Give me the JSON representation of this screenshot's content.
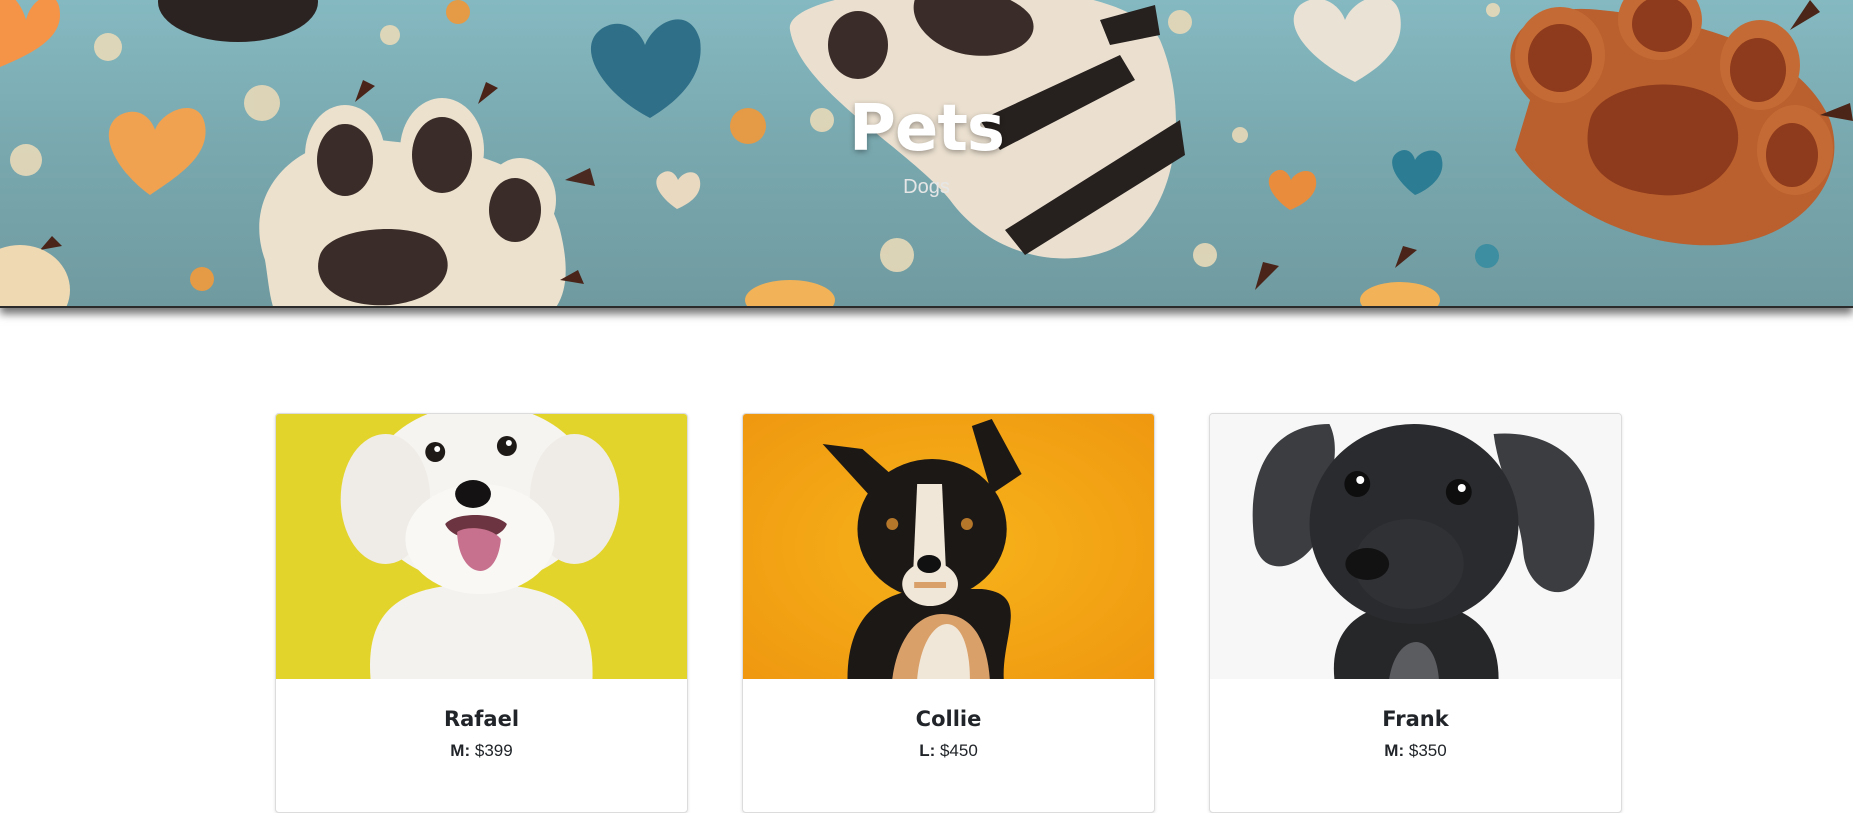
{
  "hero": {
    "title": "Pets",
    "subtitle": "Dogs",
    "background_colors": {
      "sky": "#7aa9b0",
      "paw_cream": "#ede2d2",
      "paw_dark": "#3a2a26",
      "paw_brown": "#b5562b",
      "heart_orange": "#f0a050",
      "heart_teal": "#2b6f86"
    }
  },
  "pets": [
    {
      "name": "Rafael",
      "size_label": "M:",
      "price": "$399",
      "image_background": "#e3d42c",
      "breed_icon": "white-fluffy-dog-photo"
    },
    {
      "name": "Collie",
      "size_label": "L:",
      "price": "$450",
      "image_background": "#f5ac18",
      "breed_icon": "border-collie-dog-photo"
    },
    {
      "name": "Frank",
      "size_label": "M:",
      "price": "$350",
      "image_background": "#f7f7f7",
      "breed_icon": "black-puppy-dog-photo"
    }
  ]
}
